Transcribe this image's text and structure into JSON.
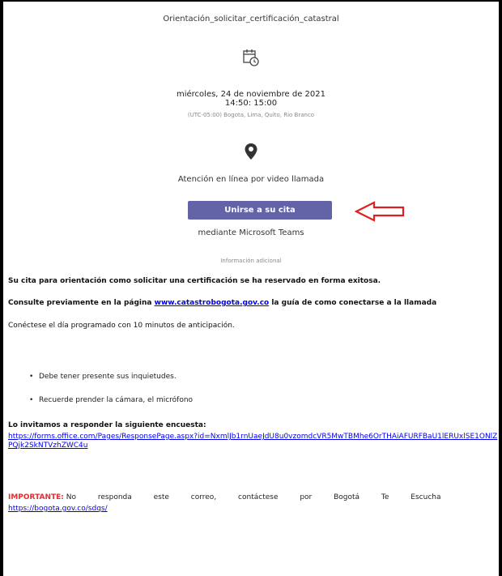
{
  "event": {
    "title": "Orientación_solicitar_certificación_catastral",
    "date": "miércoles, 24 de noviembre de 2021",
    "time": "14:50: 15:00",
    "timezone": "(UTC-05:00) Bogota, Lima, Quito, Rio Branco",
    "location": "Atención en línea por video llamada",
    "join_label": "Unirse a su cita",
    "via": "mediante Microsoft Teams",
    "info_header": "Información adicional"
  },
  "body": {
    "confirmation": "Su cita para orientación como solicitar una certificación se ha reservado en forma exitosa.",
    "consult_prefix": "Consulte previamente en la página ",
    "consult_link": "www.catastrobogota.gov.co",
    "consult_suffix": " la guía de como conectarse a la llamada",
    "connect": "Conéctese el día programado con 10 minutos de anticipación.",
    "bullets": [
      "Debe tener presente sus inquietudes.",
      "Recuerde prender la cámara, el micrófono"
    ],
    "survey_label": "Lo invitamos a responder la siguiente encuesta:",
    "survey_url": "https://forms.office.com/Pages/ResponsePage.aspx?id=NxmlJb1rnUaeJdU8u0vzomdcVR5MwTBMhe6OrTHAiAFURFBaU1lERUxlSE1ONlZPQjk2SkNTVzhZWC4u",
    "important_label": "IMPORTANTE:",
    "important_text": "No responda este correo, contáctese por Bogotá Te Escucha",
    "important_link": "https://bogota.gov.co/sdqs/"
  },
  "colors": {
    "button": "#6264a7",
    "important": "#e03030",
    "arrow": "#e02020"
  }
}
